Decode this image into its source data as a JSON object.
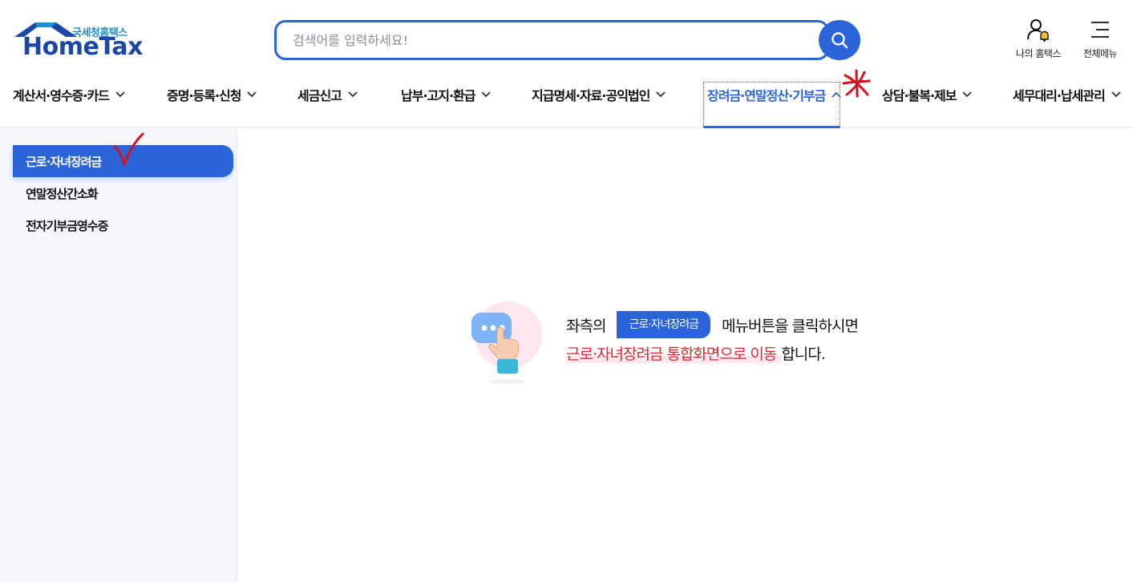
{
  "header": {
    "logo_sub": "국세청홈택스",
    "logo_main": "HomeTax",
    "search_placeholder": "검색어를 입력하세요!",
    "my_hometax_label": "나의 홈택스",
    "all_menu_label": "전체메뉴"
  },
  "gnb": {
    "items": [
      {
        "label": "계산서·영수증·카드"
      },
      {
        "label": "증명·등록·신청"
      },
      {
        "label": "세금신고"
      },
      {
        "label": "납부·고지·환급"
      },
      {
        "label": "지급명세·자료·공익법인"
      },
      {
        "label": "장려금·연말정산·기부금"
      },
      {
        "label": "상담·불복·제보"
      },
      {
        "label": "세무대리·납세관리"
      }
    ]
  },
  "sidebar": {
    "items": [
      {
        "label": "근로·자녀장려금"
      },
      {
        "label": "연말정산간소화"
      },
      {
        "label": "전자기부금영수증"
      }
    ]
  },
  "guide": {
    "prefix": "좌측의",
    "chip": "근로·자녀장려금",
    "suffix": "메뉴버튼을 클릭하시면",
    "highlight": "근로·자녀장려금 통합화면으로 이동",
    "tail": "합니다."
  },
  "colors": {
    "accent": "#2a64d8",
    "highlight_text": "#e0282e",
    "sidebar_bg": "#f5f7fd"
  }
}
